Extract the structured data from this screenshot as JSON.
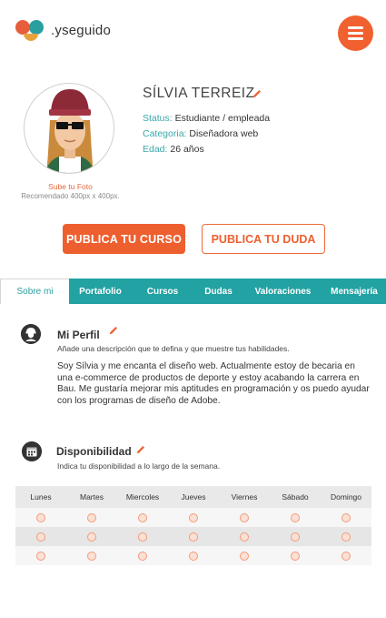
{
  "brand": {
    "name": ".yseguido"
  },
  "profile": {
    "name": "SÍLVIA TERREIZ",
    "status_label": "Status:",
    "status_value": "Estudiante / empleada",
    "category_label": "Categoria:",
    "category_value": "Diseñadora web",
    "age_label": "Edad:",
    "age_value": "26 años",
    "upload_label": "Sube tu Foto",
    "upload_hint": "Recomendado 400px x 400px."
  },
  "actions": {
    "publish_course": "PUBLICA TU CURSO",
    "publish_doubt": "PUBLICA TU DUDA"
  },
  "tabs": [
    {
      "label": "Sobre mi",
      "active": true
    },
    {
      "label": "Portafolio",
      "active": false
    },
    {
      "label": "Cursos",
      "active": false
    },
    {
      "label": "Dudas",
      "active": false
    },
    {
      "label": "Valoraciones",
      "active": false
    },
    {
      "label": "Mensajería",
      "active": false
    }
  ],
  "profile_section": {
    "title": "Mi Perfil",
    "subtitle": "Añade una descripción que te defina y que muestre tus habilidades.",
    "bio": "Soy Sílvia y me encanta el diseño web. Actualmente estoy de becaria en una e-commerce de productos de deporte y estoy acabando la carrera en Bau. Me gustaría mejorar mis aptitudes en programación y os puedo ayudar con los programas de diseño de Adobe."
  },
  "availability": {
    "title": "Disponibilidad",
    "subtitle": "Indica tu disponibilidad a lo largo de la semana.",
    "days": [
      "Lunes",
      "Martes",
      "Miercoles",
      "Jueves",
      "Viernes",
      "Sábado",
      "Domingo"
    ],
    "slot_rows": 3
  },
  "colors": {
    "accent": "#ee5f2f",
    "teal": "#22a2a3"
  }
}
